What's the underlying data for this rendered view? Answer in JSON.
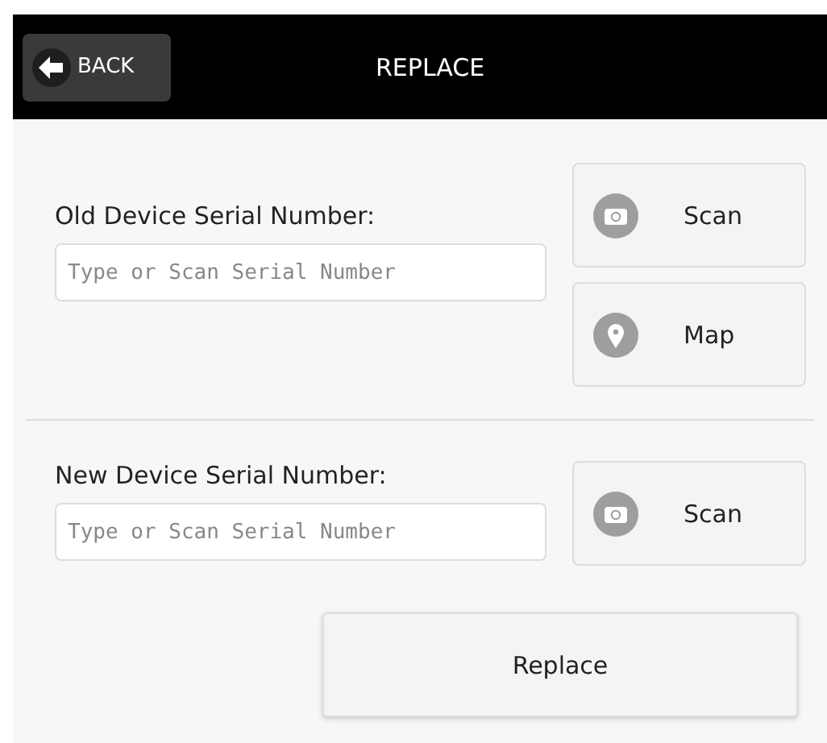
{
  "header": {
    "back_button": "BACK",
    "title": "REPLACE"
  },
  "sections": [
    {
      "label": "Old Device Serial Number:",
      "placeholder": "Type or Scan Serial Number",
      "actions": [
        {
          "kind": "scan",
          "label": "Scan"
        },
        {
          "kind": "map",
          "label": "Map"
        }
      ]
    },
    {
      "label": "New Device Serial Number:",
      "placeholder": "Type or Scan Serial Number",
      "actions": [
        {
          "kind": "scan",
          "label": "Scan"
        }
      ]
    }
  ],
  "submit_button": "Replace"
}
